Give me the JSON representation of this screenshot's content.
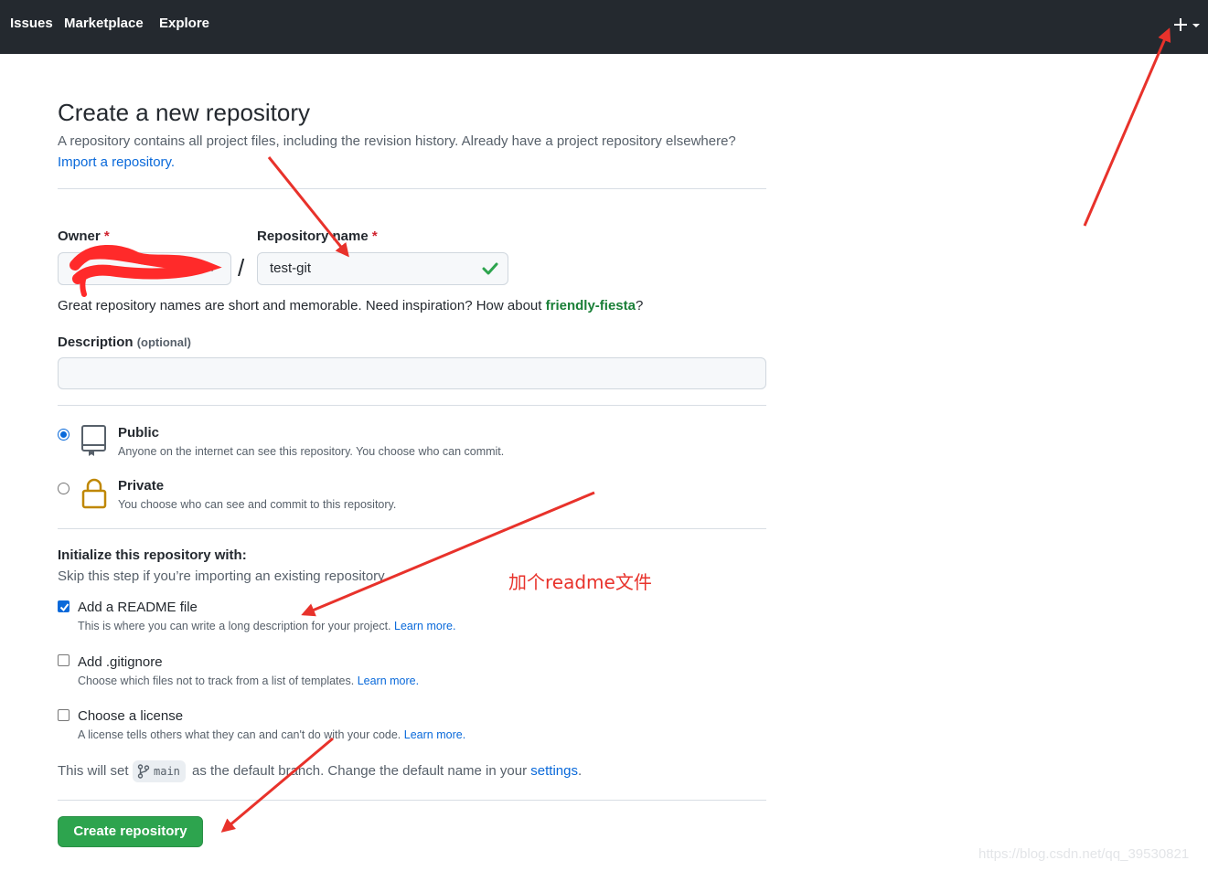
{
  "nav": {
    "items": [
      {
        "label": "Issues"
      },
      {
        "label": "Marketplace"
      },
      {
        "label": "Explore"
      }
    ],
    "plus_icon": "plus-icon",
    "caret_icon": "caret-down-icon"
  },
  "page": {
    "title": "Create a new repository",
    "subtitle": "A repository contains all project files, including the revision history. Already have a project repository elsewhere?",
    "import_link": "Import a repository."
  },
  "form": {
    "owner_label": "Owner",
    "required_mark": "*",
    "slash": "/",
    "repo_name_label": "Repository name",
    "repo_name_value": "test-git",
    "hint_prefix": "Great repository names are short and memorable. Need inspiration? How about",
    "hint_suggestion": "friendly-fiesta",
    "hint_suffix": "?",
    "description_label": "Description",
    "description_optional": "(optional)",
    "description_value": ""
  },
  "visibility": {
    "options": [
      {
        "title": "Public",
        "desc": "Anyone on the internet can see this repository. You choose who can commit.",
        "selected": true,
        "icon": "repo-icon"
      },
      {
        "title": "Private",
        "desc": "You choose who can see and commit to this repository.",
        "selected": false,
        "icon": "lock-icon"
      }
    ]
  },
  "init": {
    "heading": "Initialize this repository with:",
    "subheading": "Skip this step if you’re importing an existing repository.",
    "options": [
      {
        "title": "Add a README file",
        "desc": "This is where you can write a long description for your project.",
        "link": "Learn more.",
        "checked": true
      },
      {
        "title": "Add .gitignore",
        "desc": "Choose which files not to track from a list of templates.",
        "link": "Learn more.",
        "checked": false
      },
      {
        "title": "Choose a license",
        "desc": "A license tells others what they can and can't do with your code.",
        "link": "Learn more.",
        "checked": false
      }
    ]
  },
  "branch": {
    "prefix": "This will set",
    "name": "main",
    "middle": "as the default branch. Change the default name in your",
    "settings_link": "settings",
    "suffix": "."
  },
  "submit": {
    "label": "Create repository"
  },
  "annotation": {
    "text": "加个readme文件"
  },
  "watermark": {
    "text": "https://blog.csdn.net/qq_39530821"
  },
  "colors": {
    "header_bg": "#24292f",
    "link": "#0969da",
    "button_green": "#2da44e",
    "annotation_red": "#e8322b",
    "private_lock": "#bf8700"
  }
}
